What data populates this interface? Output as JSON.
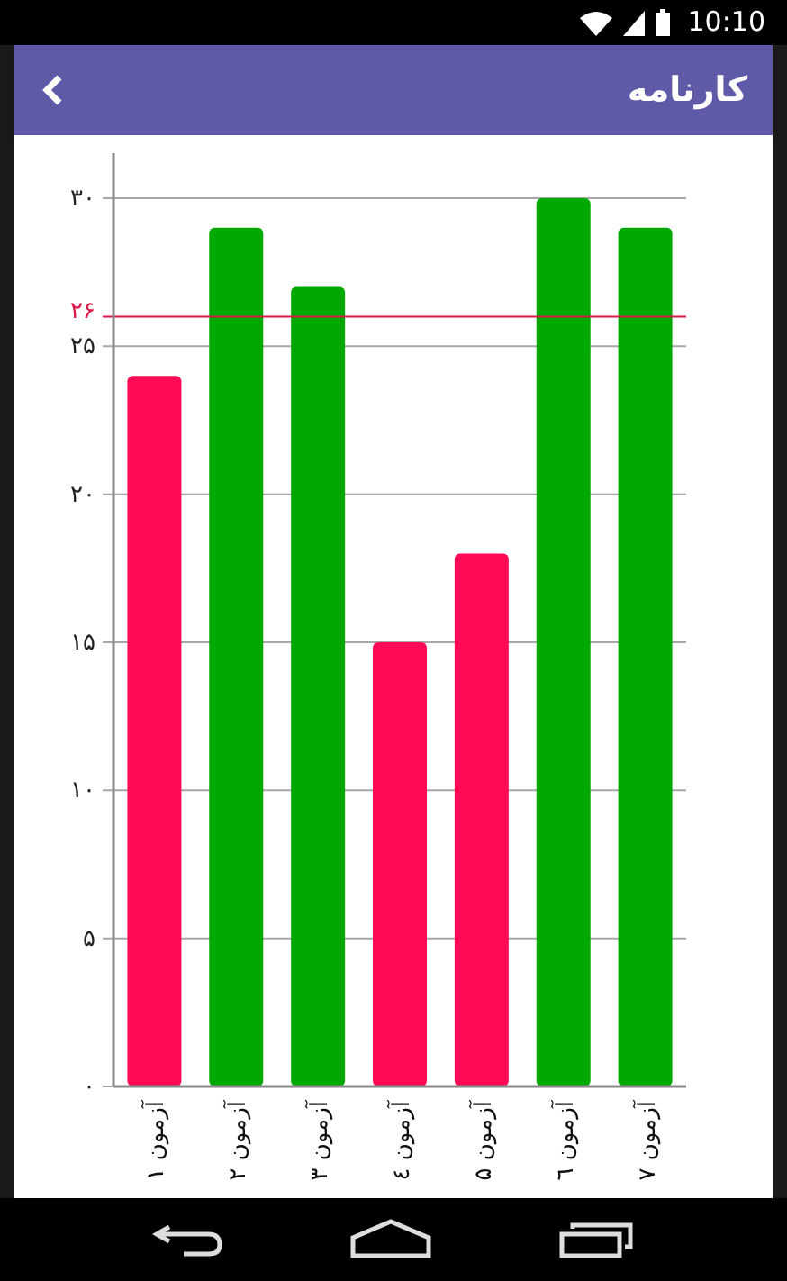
{
  "status_bar": {
    "time": "10:10"
  },
  "app_bar": {
    "title": "کارنامه"
  },
  "chart": {
    "chart_data": {
      "type": "bar",
      "categories": [
        "آزمون ۱",
        "آزمون ۲",
        "آزمون ۳",
        "آزمون ٤",
        "آزمون ۵",
        "آزمون ٦",
        "آزمون ۷"
      ],
      "series": [
        {
          "values": [
            24,
            29,
            27,
            15,
            18,
            30,
            29
          ],
          "colors": [
            "#ff0a55",
            "#00a900",
            "#00a900",
            "#ff0a55",
            "#ff0a55",
            "#00a900",
            "#00a900"
          ]
        }
      ],
      "ylim": [
        0,
        30
      ],
      "yticks": [
        {
          "value": 0,
          "label": "۰"
        },
        {
          "value": 5,
          "label": "۵"
        },
        {
          "value": 10,
          "label": "۱۰"
        },
        {
          "value": 15,
          "label": "۱۵"
        },
        {
          "value": 20,
          "label": "۲۰"
        },
        {
          "value": 25,
          "label": "۲۵"
        },
        {
          "value": 30,
          "label": "۳۰"
        }
      ],
      "grid": true,
      "ref_lines": [
        {
          "axis": "y",
          "value": 26,
          "label": "۲۶",
          "color": "#d81b4a"
        }
      ]
    }
  }
}
